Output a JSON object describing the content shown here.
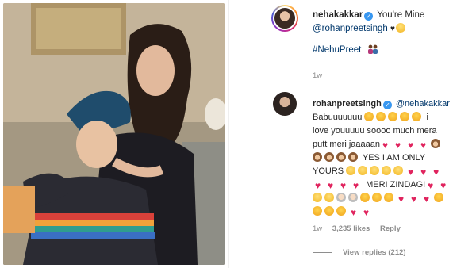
{
  "post": {
    "username": "nehakakkar",
    "caption": "You're Mine",
    "mention": "@rohanpreetsingh",
    "heart": "♥",
    "hashtag": "#NehuPreet",
    "time": "1w"
  },
  "comment": {
    "username": "rohanpreetsingh",
    "mention": "@nehakakkar",
    "text_1": "Babuuuuuuu",
    "text_2": "i",
    "text_3": "love youuuuu soooo much mera",
    "text_4": "putt meri jaaaaan",
    "text_5": "YES I AM ONLY",
    "text_6": "YOURS",
    "text_7": "MERI ZINDAGI",
    "time": "1w",
    "likes": "3,235 likes",
    "reply": "Reply",
    "view_replies": "View replies (212)"
  },
  "colors": {
    "link": "#00376b",
    "meta": "#8e8e8e",
    "verified": "#3897f0",
    "heart": "#e0245e"
  }
}
